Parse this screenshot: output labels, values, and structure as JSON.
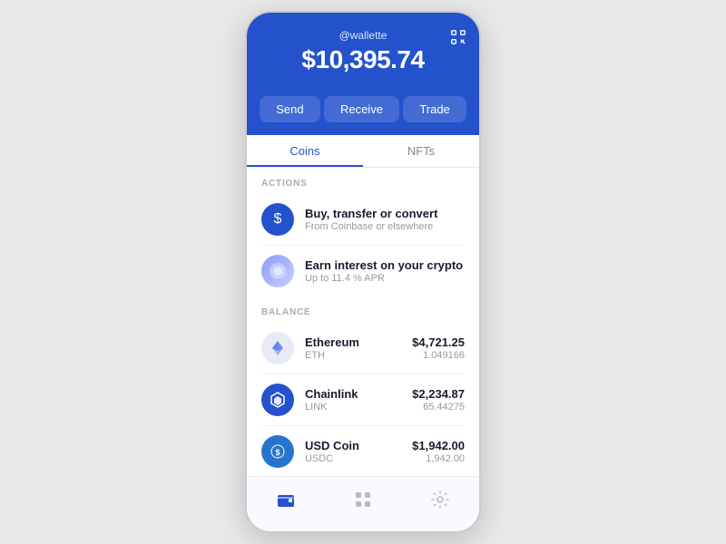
{
  "header": {
    "username": "@wallette",
    "balance": "$10,395.74"
  },
  "action_buttons": {
    "send": "Send",
    "receive": "Receive",
    "trade": "Trade"
  },
  "tabs": [
    {
      "label": "Coins",
      "active": true
    },
    {
      "label": "NFTs",
      "active": false
    }
  ],
  "actions_section": {
    "label": "ACTIONS",
    "items": [
      {
        "title": "Buy, transfer or convert",
        "subtitle": "From Coinbase or elsewhere",
        "icon": "$"
      },
      {
        "title": "Earn interest on your crypto",
        "subtitle": "Up to 11.4 % APR",
        "icon": "◉"
      }
    ]
  },
  "balance_section": {
    "label": "BALANCE",
    "items": [
      {
        "name": "Ethereum",
        "symbol": "ETH",
        "amount": "$4,721.25",
        "quantity": "1.049166"
      },
      {
        "name": "Chainlink",
        "symbol": "LINK",
        "amount": "$2,234.87",
        "quantity": "65.44275"
      },
      {
        "name": "USD Coin",
        "symbol": "USDC",
        "amount": "$1,942.00",
        "quantity": "1,942.00"
      }
    ]
  },
  "bottom_nav": [
    {
      "label": "wallet",
      "active": true
    },
    {
      "label": "grid",
      "active": false
    },
    {
      "label": "settings",
      "active": false
    }
  ]
}
